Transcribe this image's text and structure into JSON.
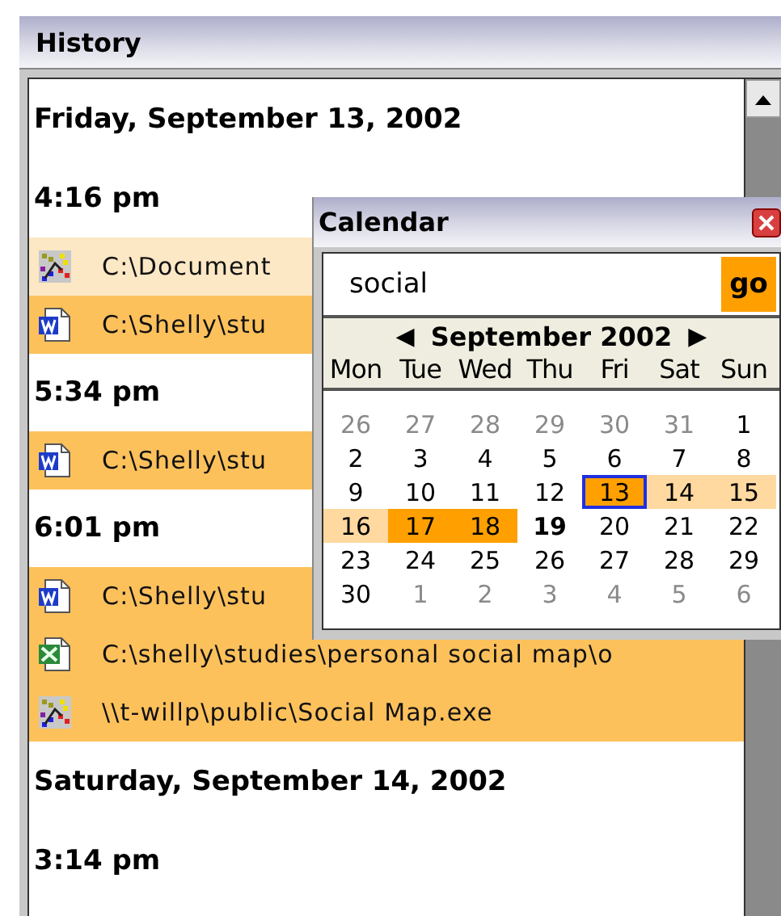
{
  "history": {
    "title": "History",
    "entries": [
      {
        "kind": "date",
        "text": "Friday, September 13, 2002"
      },
      {
        "kind": "time",
        "text": "4:16 pm"
      },
      {
        "kind": "map_file",
        "color": "#fde8c6",
        "text": "C:\\Document"
      },
      {
        "kind": "word_file",
        "color": "#fdc15c",
        "text": "C:\\Shelly\\stu"
      },
      {
        "kind": "time",
        "text": "5:34 pm"
      },
      {
        "kind": "word_file",
        "color": "#fdc15c",
        "text": "C:\\Shelly\\stu"
      },
      {
        "kind": "time",
        "text": "6:01 pm"
      },
      {
        "kind": "word_file",
        "color": "#fdc15c",
        "text": "C:\\Shelly\\stu"
      },
      {
        "kind": "excel_file",
        "color": "#fdc15c",
        "text": "C:\\shelly\\studies\\personal social map\\o"
      },
      {
        "kind": "map_file",
        "color": "#fdc15c",
        "text": "\\\\t-willp\\public\\Social Map.exe"
      },
      {
        "kind": "date",
        "text": "Saturday, September 14, 2002"
      },
      {
        "kind": "time",
        "text": "3:14 pm"
      }
    ]
  },
  "calendar": {
    "title": "Calendar",
    "search": {
      "value": "social"
    },
    "go_button": "go",
    "prev": "◀",
    "month": "September 2002",
    "next": "▶",
    "weekdays": [
      "Mon",
      "Tue",
      "Wed",
      "Thu",
      "Fri",
      "Sat",
      "Sun"
    ],
    "weeks": [
      [
        {
          "day": "26",
          "in_month": false,
          "selected": false,
          "today": false
        },
        {
          "day": "27",
          "in_month": false,
          "selected": false,
          "today": false
        },
        {
          "day": "28",
          "in_month": false,
          "selected": false,
          "today": false
        },
        {
          "day": "29",
          "in_month": false,
          "selected": false,
          "today": false
        },
        {
          "day": "30",
          "in_month": false,
          "selected": false,
          "today": false
        },
        {
          "day": "31",
          "in_month": false,
          "selected": false,
          "today": false
        },
        {
          "day": "1",
          "in_month": true,
          "selected": false,
          "today": false
        }
      ],
      [
        {
          "day": "2",
          "in_month": true,
          "selected": false,
          "today": false
        },
        {
          "day": "3",
          "in_month": true,
          "selected": false,
          "today": false
        },
        {
          "day": "4",
          "in_month": true,
          "selected": false,
          "today": false
        },
        {
          "day": "5",
          "in_month": true,
          "selected": false,
          "today": false
        },
        {
          "day": "6",
          "in_month": true,
          "selected": false,
          "today": false
        },
        {
          "day": "7",
          "in_month": true,
          "selected": false,
          "today": false
        },
        {
          "day": "8",
          "in_month": true,
          "selected": false,
          "today": false
        }
      ],
      [
        {
          "day": "9",
          "in_month": true,
          "selected": false,
          "today": false
        },
        {
          "day": "10",
          "in_month": true,
          "selected": false,
          "today": false
        },
        {
          "day": "11",
          "in_month": true,
          "selected": false,
          "today": false
        },
        {
          "day": "12",
          "in_month": true,
          "selected": false,
          "today": false
        },
        {
          "day": "13",
          "in_month": true,
          "color": "#ffa000",
          "selected": true,
          "today": false
        },
        {
          "day": "14",
          "in_month": true,
          "color": "#ffd9a0",
          "selected": false,
          "today": false
        },
        {
          "day": "15",
          "in_month": true,
          "color": "#ffd9a0",
          "selected": false,
          "today": false
        }
      ],
      [
        {
          "day": "16",
          "in_month": true,
          "color": "#ffd9a0",
          "selected": false,
          "today": false
        },
        {
          "day": "17",
          "in_month": true,
          "color": "#ffa000",
          "selected": false,
          "today": false
        },
        {
          "day": "18",
          "in_month": true,
          "color": "#ffa000",
          "selected": false,
          "today": false
        },
        {
          "day": "19",
          "in_month": true,
          "selected": false,
          "today": true
        },
        {
          "day": "20",
          "in_month": true,
          "selected": false,
          "today": false
        },
        {
          "day": "21",
          "in_month": true,
          "selected": false,
          "today": false
        },
        {
          "day": "22",
          "in_month": true,
          "selected": false,
          "today": false
        }
      ],
      [
        {
          "day": "23",
          "in_month": true,
          "selected": false,
          "today": false
        },
        {
          "day": "24",
          "in_month": true,
          "selected": false,
          "today": false
        },
        {
          "day": "25",
          "in_month": true,
          "selected": false,
          "today": false
        },
        {
          "day": "26",
          "in_month": true,
          "selected": false,
          "today": false
        },
        {
          "day": "27",
          "in_month": true,
          "selected": false,
          "today": false
        },
        {
          "day": "28",
          "in_month": true,
          "selected": false,
          "today": false
        },
        {
          "day": "29",
          "in_month": true,
          "selected": false,
          "today": false
        }
      ],
      [
        {
          "day": "30",
          "in_month": true,
          "selected": false,
          "today": false
        },
        {
          "day": "1",
          "in_month": false,
          "selected": false,
          "today": false
        },
        {
          "day": "2",
          "in_month": false,
          "selected": false,
          "today": false
        },
        {
          "day": "3",
          "in_month": false,
          "selected": false,
          "today": false
        },
        {
          "day": "4",
          "in_month": false,
          "selected": false,
          "today": false
        },
        {
          "day": "5",
          "in_month": false,
          "selected": false,
          "today": false
        },
        {
          "day": "6",
          "in_month": false,
          "selected": false,
          "today": false
        }
      ]
    ]
  }
}
